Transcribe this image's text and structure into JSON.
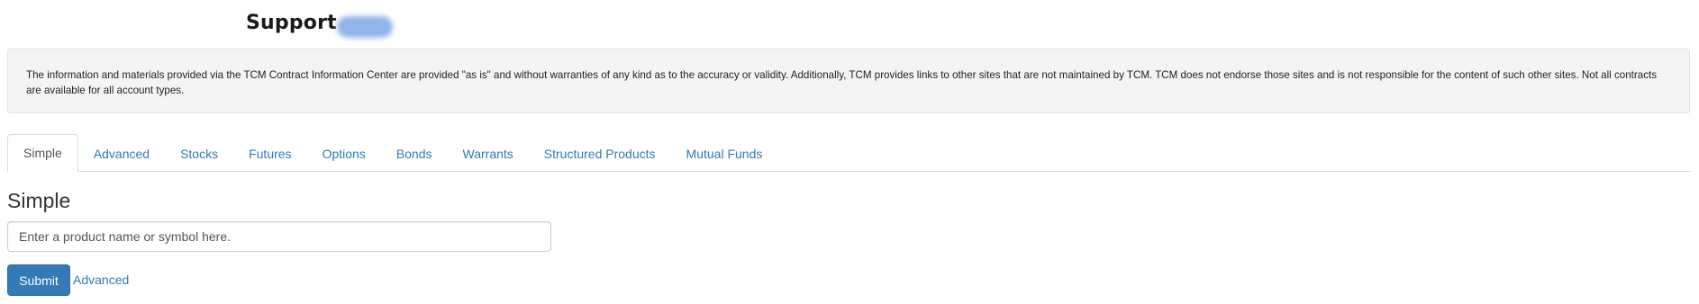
{
  "header": {
    "title": "Support"
  },
  "disclaimer": {
    "text": "The information and materials provided via the TCM Contract Information Center are provided \"as is\" and without warranties of any kind as to the accuracy or validity. Additionally, TCM provides links to other sites that are not maintained by TCM. TCM does not endorse those sites and is not responsible for the content of such other sites. Not all contracts are available for all account types."
  },
  "tabs": [
    {
      "label": "Simple",
      "active": true
    },
    {
      "label": "Advanced",
      "active": false
    },
    {
      "label": "Stocks",
      "active": false
    },
    {
      "label": "Futures",
      "active": false
    },
    {
      "label": "Options",
      "active": false
    },
    {
      "label": "Bonds",
      "active": false
    },
    {
      "label": "Warrants",
      "active": false
    },
    {
      "label": "Structured Products",
      "active": false
    },
    {
      "label": "Mutual Funds",
      "active": false
    }
  ],
  "main": {
    "heading": "Simple",
    "search": {
      "placeholder": "Enter a product name or symbol here.",
      "value": ""
    },
    "submit_label": "Submit",
    "advanced_link": "Advanced"
  },
  "colors": {
    "link": "#337ab7",
    "button": "#337ab7",
    "panel_bg": "#f4f4f4"
  }
}
